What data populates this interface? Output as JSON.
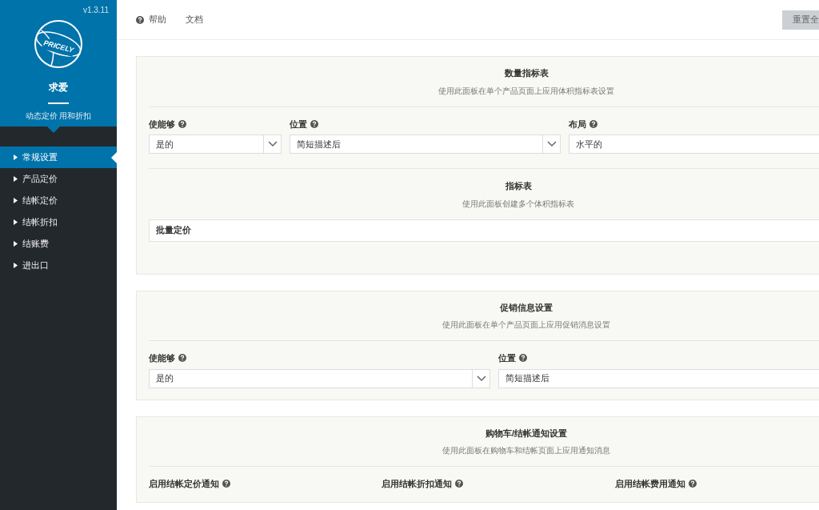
{
  "sidebar": {
    "version": "v1.3.11",
    "logo_text": "PRICELY",
    "plugin_name": "求爱",
    "tagline": "动态定价 用和折扣",
    "items": [
      {
        "label": "常规设置",
        "selected": true
      },
      {
        "label": "产品定价",
        "selected": false
      },
      {
        "label": "结帐定价",
        "selected": false
      },
      {
        "label": "结帐折扣",
        "selected": false
      },
      {
        "label": "结账费",
        "selected": false
      },
      {
        "label": "进出口",
        "selected": false
      }
    ]
  },
  "topbar": {
    "links": [
      {
        "label": "帮助",
        "kind": "help"
      },
      {
        "label": "文档",
        "kind": "plain"
      }
    ],
    "reset_button": "重置全"
  },
  "sections": [
    {
      "title": "数量指标表",
      "description": "使用此面板在单个产品页面上应用体积指标表设置",
      "fields": [
        {
          "label": "使能够",
          "value": "是的",
          "kind": "select"
        },
        {
          "label": "位置",
          "value": "简短描述后",
          "kind": "select"
        },
        {
          "label": "布局",
          "value": "水平的",
          "kind": "text"
        }
      ],
      "subsection": {
        "title": "指标表",
        "description": "使用此面板创建多个体积指标表",
        "item": "批量定价"
      }
    },
    {
      "title": "促销信息设置",
      "description": "使用此面板在单个产品页面上应用促销消息设置",
      "fields": [
        {
          "label": "使能够",
          "value": "是的",
          "kind": "select"
        },
        {
          "label": "位置",
          "value": "简短描述后",
          "kind": "text"
        }
      ]
    },
    {
      "title": "购物车/结帐通知设置",
      "description": "使用此面板在购物车和结帐页面上应用通知消息",
      "fields": [
        {
          "label": "启用结帐定价通知",
          "kind": "label"
        },
        {
          "label": "启用结帐折扣通知",
          "kind": "label"
        },
        {
          "label": "启用结帐费用通知",
          "kind": "label"
        }
      ]
    }
  ]
}
